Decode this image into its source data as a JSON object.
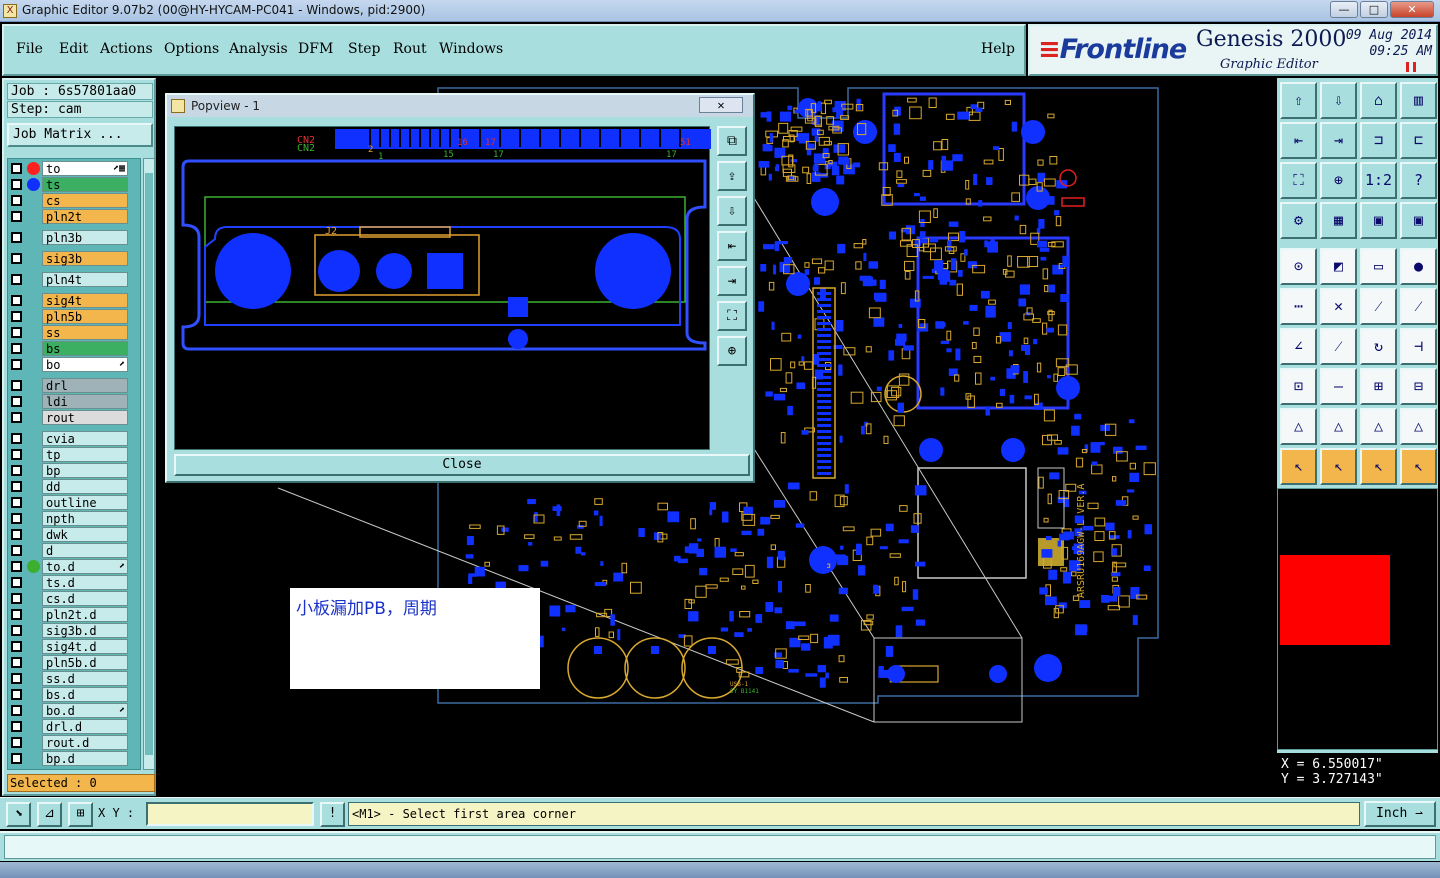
{
  "window": {
    "title": "Graphic Editor 9.07b2 (00@HY-HYCAM-PC041 - Windows, pid:2900)",
    "app_icon": "X",
    "minimize": "—",
    "maximize": "□",
    "close": "✕"
  },
  "menu": {
    "items": [
      {
        "label": "File"
      },
      {
        "label": "Edit"
      },
      {
        "label": "Actions"
      },
      {
        "label": "Options"
      },
      {
        "label": "Analysis"
      },
      {
        "label": "DFM"
      },
      {
        "label": "Step"
      },
      {
        "label": "Rout"
      },
      {
        "label": "Windows"
      }
    ],
    "help": "Help"
  },
  "brand": {
    "logo_bar": "≡",
    "logo": "Frontline",
    "product": "Genesis 2000",
    "subtitle": "Graphic Editor",
    "date": "09  Aug 2014",
    "time": "09:25 AM"
  },
  "job": {
    "job_label": "Job : 6s57801aa0",
    "step_label": "Step: cam",
    "matrix_button": "Job Matrix ...",
    "selected": "Selected : 0"
  },
  "layers": [
    {
      "name": "to",
      "color": "#ffffff",
      "dot": "#ff2020",
      "mark": "⬈▦"
    },
    {
      "name": "ts",
      "color": "#3caf62",
      "dot": "#1030ff",
      "mark": ""
    },
    {
      "name": "cs",
      "color": "#f2b64d",
      "dot": "",
      "mark": ""
    },
    {
      "name": "pln2t",
      "color": "#f2b64d",
      "dot": "",
      "mark": ""
    },
    {
      "name": "pln3b",
      "color": "#c7eaea",
      "dot": "",
      "mark": ""
    },
    {
      "name": "sig3b",
      "color": "#f2b64d",
      "dot": "",
      "mark": ""
    },
    {
      "name": "pln4t",
      "color": "#c7eaea",
      "dot": "",
      "mark": ""
    },
    {
      "name": "sig4t",
      "color": "#f2b64d",
      "dot": "",
      "mark": ""
    },
    {
      "name": "pln5b",
      "color": "#f2b64d",
      "dot": "",
      "mark": ""
    },
    {
      "name": "ss",
      "color": "#f2b64d",
      "dot": "",
      "mark": ""
    },
    {
      "name": "bs",
      "color": "#3caf62",
      "dot": "",
      "mark": ""
    },
    {
      "name": "bo",
      "color": "#ffffff",
      "dot": "",
      "mark": "⬈"
    },
    {
      "name": "drl",
      "color": "#9fb2b8",
      "dot": "",
      "mark": ""
    },
    {
      "name": "ldi",
      "color": "#9fb2b8",
      "dot": "",
      "mark": ""
    },
    {
      "name": "rout",
      "color": "#dcdcdc",
      "dot": "",
      "mark": ""
    },
    {
      "name": "cvia",
      "color": "#c7eaea",
      "dot": "",
      "mark": ""
    },
    {
      "name": "tp",
      "color": "#c7eaea",
      "dot": "",
      "mark": ""
    },
    {
      "name": "bp",
      "color": "#c7eaea",
      "dot": "",
      "mark": ""
    },
    {
      "name": "dd",
      "color": "#c7eaea",
      "dot": "",
      "mark": ""
    },
    {
      "name": "outline",
      "color": "#c7eaea",
      "dot": "",
      "mark": ""
    },
    {
      "name": "npth",
      "color": "#c7eaea",
      "dot": "",
      "mark": ""
    },
    {
      "name": "dwk",
      "color": "#c7eaea",
      "dot": "",
      "mark": ""
    },
    {
      "name": "d",
      "color": "#c7eaea",
      "dot": "",
      "mark": ""
    },
    {
      "name": "to.d",
      "color": "#c7eaea",
      "dot": "#3caf30",
      "mark": "⬈"
    },
    {
      "name": "ts.d",
      "color": "#c7eaea",
      "dot": "",
      "mark": ""
    },
    {
      "name": "cs.d",
      "color": "#c7eaea",
      "dot": "",
      "mark": ""
    },
    {
      "name": "pln2t.d",
      "color": "#c7eaea",
      "dot": "",
      "mark": ""
    },
    {
      "name": "sig3b.d",
      "color": "#c7eaea",
      "dot": "",
      "mark": ""
    },
    {
      "name": "sig4t.d",
      "color": "#c7eaea",
      "dot": "",
      "mark": ""
    },
    {
      "name": "pln5b.d",
      "color": "#c7eaea",
      "dot": "",
      "mark": ""
    },
    {
      "name": "ss.d",
      "color": "#c7eaea",
      "dot": "",
      "mark": ""
    },
    {
      "name": "bs.d",
      "color": "#c7eaea",
      "dot": "",
      "mark": ""
    },
    {
      "name": "bo.d",
      "color": "#c7eaea",
      "dot": "",
      "mark": "⬈"
    },
    {
      "name": "drl.d",
      "color": "#c7eaea",
      "dot": "",
      "mark": ""
    },
    {
      "name": "rout.d",
      "color": "#c7eaea",
      "dot": "",
      "mark": ""
    },
    {
      "name": "bp.d",
      "color": "#c7eaea",
      "dot": "",
      "mark": ""
    }
  ],
  "popview": {
    "title": "Popview - 1",
    "close_x": "✕",
    "close_button": "Close",
    "labels": {
      "cn2": "CN2",
      "cn2b": "CN2",
      "j2": "J2",
      "p1": "1",
      "p2": "2",
      "p15": "15",
      "p16": "16",
      "p17": "17",
      "p17b": "17",
      "p51": "51"
    },
    "tools": [
      "⧉",
      "⇪",
      "⇩",
      "⇤",
      "⇥",
      "⛶",
      "⊕"
    ]
  },
  "board": {
    "silk_text": "ARSRU169AGW-L VER.A",
    "small_text": "USB-1",
    "rotated_text": "SY B1141"
  },
  "note": {
    "text": "小板漏加PB，周期"
  },
  "tools": {
    "icons": [
      "⇧",
      "⇩",
      "⌂",
      "▥",
      "⇤",
      "⇥",
      "⊐",
      "⊏",
      "⛶",
      "⊕",
      "1:2",
      "?",
      "⚙",
      "▦",
      "▣",
      "▣",
      "⊙",
      "◩",
      "▭",
      "●",
      "⋯",
      "✕",
      "⁄",
      "⁄",
      "∠",
      "⁄",
      "↻",
      "⊣",
      "⊡",
      "—",
      "⊞",
      "⊟",
      "△",
      "△",
      "△",
      "△",
      "↖",
      "↖",
      "↖",
      "↖"
    ]
  },
  "coords": {
    "x": "X  =  6.550017\"",
    "y": "Y  =  3.727143\""
  },
  "status": {
    "xy_label": "X Y :",
    "xy_value": "",
    "warn_icon": "!",
    "message": "<M1> - Select first area corner",
    "unit": "Inch ⇀"
  }
}
